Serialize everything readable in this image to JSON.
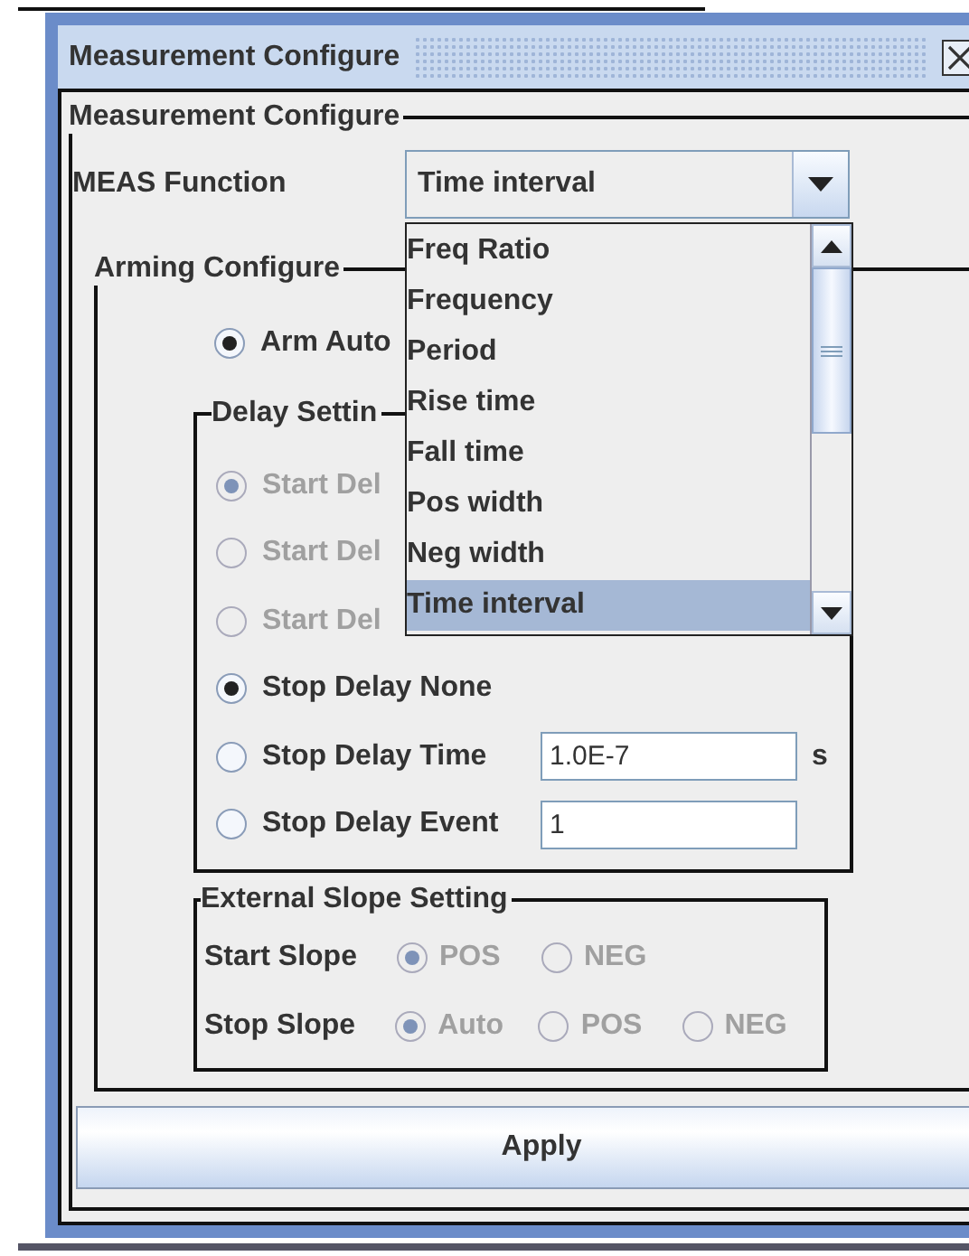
{
  "window": {
    "title": "Measurement Configure"
  },
  "panel": {
    "title": "Measurement Configure",
    "meas_function": {
      "label": "MEAS Function",
      "value": "Time interval",
      "expanded": true,
      "items": [
        {
          "label": "Freq Ratio",
          "selected": false
        },
        {
          "label": "Frequency",
          "selected": false
        },
        {
          "label": "Period",
          "selected": false
        },
        {
          "label": "Rise time",
          "selected": false
        },
        {
          "label": "Fall time",
          "selected": false
        },
        {
          "label": "Pos width",
          "selected": false
        },
        {
          "label": "Neg width",
          "selected": false
        },
        {
          "label": "Time interval",
          "selected": true
        }
      ]
    },
    "arming": {
      "title": "Arming Configure",
      "options": [
        {
          "label": "Arm Auto",
          "selected": true,
          "disabled": false
        }
      ],
      "delay": {
        "title": "Delay Settin",
        "rows": [
          {
            "kind": "radio",
            "label": "Start Del",
            "selected": true,
            "disabled": true
          },
          {
            "kind": "radio",
            "label": "Start Del",
            "selected": false,
            "disabled": true
          },
          {
            "kind": "radio",
            "label": "Start Del",
            "selected": false,
            "disabled": true
          },
          {
            "kind": "radio",
            "label": "Stop Delay None",
            "selected": true,
            "disabled": false
          },
          {
            "kind": "radio-field",
            "label": "Stop Delay Time",
            "selected": false,
            "disabled": false,
            "value": "1.0E-7",
            "unit": "s"
          },
          {
            "kind": "radio-field",
            "label": "Stop Delay Event",
            "selected": false,
            "disabled": false,
            "value": "1"
          }
        ]
      },
      "slope": {
        "title": "External Slope Setting",
        "rows": [
          {
            "label": "Start Slope",
            "options": [
              {
                "label": "POS",
                "selected": true,
                "disabled": true
              },
              {
                "label": "NEG",
                "selected": false,
                "disabled": true
              }
            ]
          },
          {
            "label": "Stop Slope",
            "options": [
              {
                "label": "Auto",
                "selected": true,
                "disabled": true
              },
              {
                "label": "POS",
                "selected": false,
                "disabled": true
              },
              {
                "label": "NEG",
                "selected": false,
                "disabled": true
              }
            ]
          }
        ]
      }
    }
  },
  "buttons": [
    {
      "label": "Apply"
    }
  ]
}
